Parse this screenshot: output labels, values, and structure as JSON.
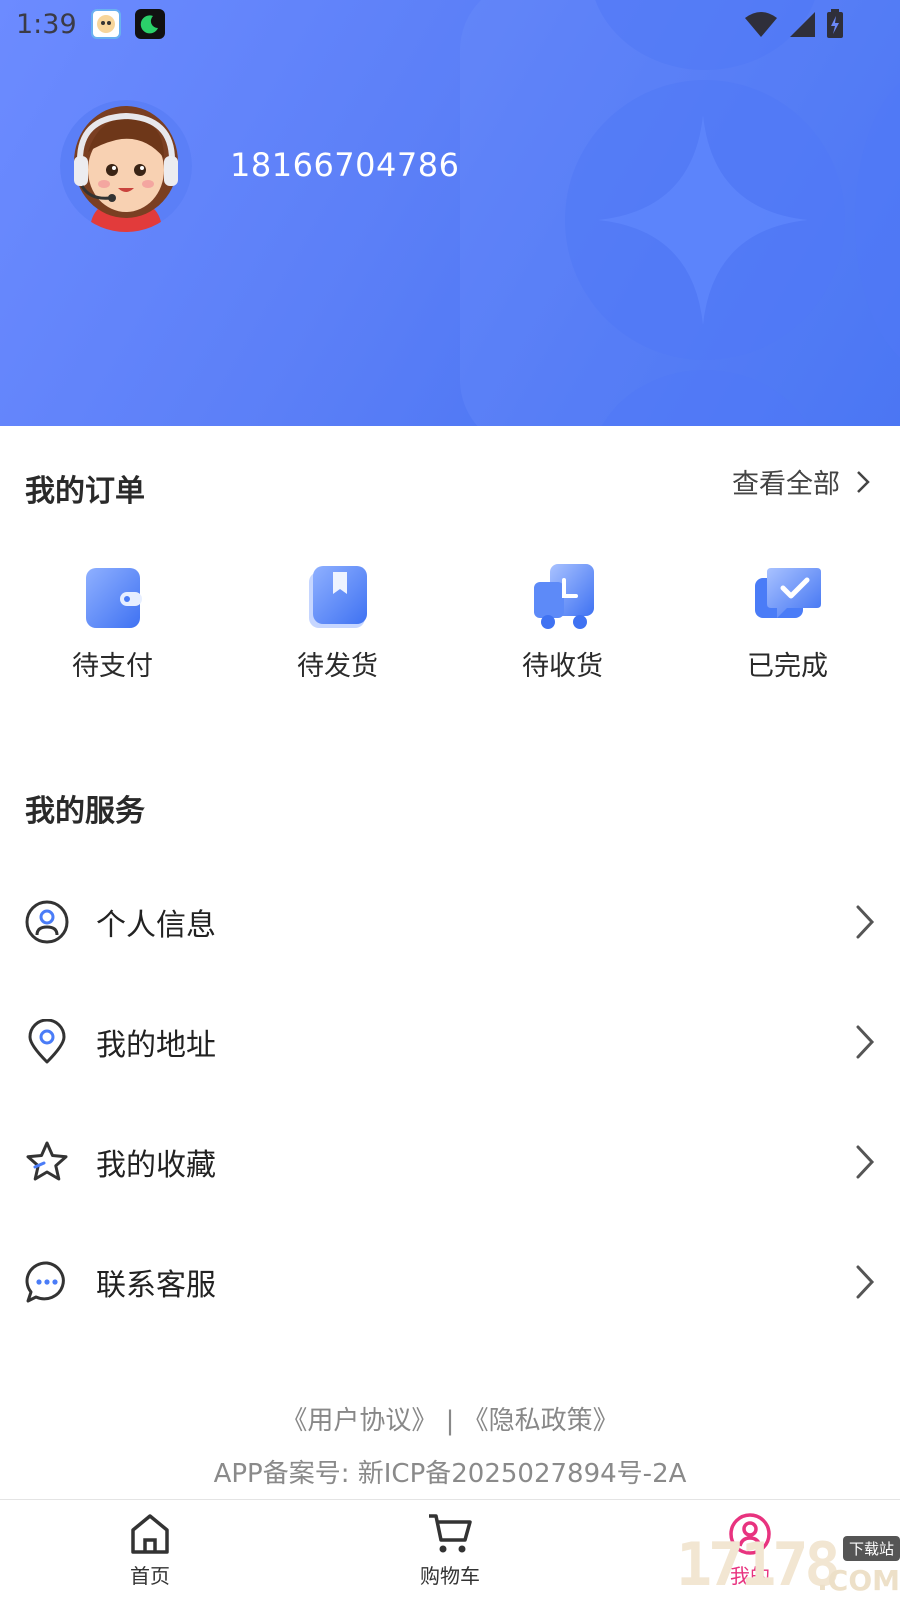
{
  "status_bar": {
    "time": "1:39"
  },
  "profile": {
    "phone": "18166704786"
  },
  "orders": {
    "title": "我的订单",
    "view_all": "查看全部",
    "items": [
      {
        "label": "待支付",
        "icon": "wallet-icon"
      },
      {
        "label": "待发货",
        "icon": "bookmark-box-icon"
      },
      {
        "label": "待收货",
        "icon": "delivery-truck-icon"
      },
      {
        "label": "已完成",
        "icon": "check-message-icon"
      }
    ]
  },
  "services": {
    "title": "我的服务",
    "items": [
      {
        "label": "个人信息",
        "icon": "user-circle-icon"
      },
      {
        "label": "我的地址",
        "icon": "location-pin-icon"
      },
      {
        "label": "我的收藏",
        "icon": "star-icon"
      },
      {
        "label": "联系客服",
        "icon": "chat-bubble-icon"
      }
    ]
  },
  "footer": {
    "user_agreement": "《用户协议》",
    "separator": "|",
    "privacy_policy": "《隐私政策》",
    "icp": "APP备案号: 新ICP备2025027894号-2A"
  },
  "tabbar": {
    "items": [
      {
        "label": "首页",
        "icon": "home-icon"
      },
      {
        "label": "购物车",
        "icon": "cart-icon"
      },
      {
        "label": "我的",
        "icon": "user-profile-icon",
        "active": true
      }
    ]
  },
  "watermark": {
    "digits": "17178",
    "badge": "下载站",
    "suffix": ".COM"
  },
  "colors": {
    "header_start": "#6c8bff",
    "header_end": "#3f6ef0",
    "icon_blue": "#4a7cf7",
    "active_tab": "#e8337f"
  }
}
